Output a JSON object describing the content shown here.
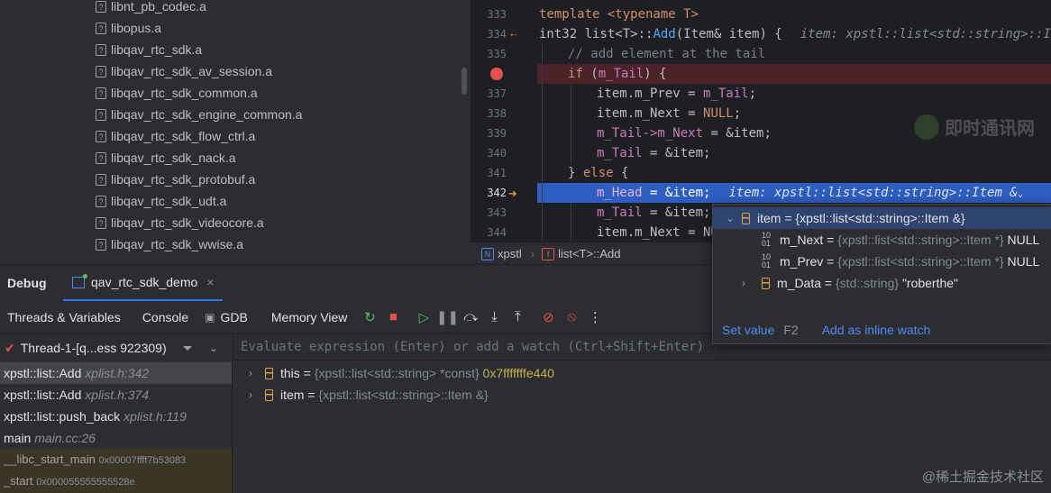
{
  "tree": {
    "files": [
      "libnt_pb_codec.a",
      "libopus.a",
      "libqav_rtc_sdk.a",
      "libqav_rtc_sdk_av_session.a",
      "libqav_rtc_sdk_common.a",
      "libqav_rtc_sdk_engine_common.a",
      "libqav_rtc_sdk_flow_ctrl.a",
      "libqav_rtc_sdk_nack.a",
      "libqav_rtc_sdk_protobuf.a",
      "libqav_rtc_sdk_udt.a",
      "libqav_rtc_sdk_videocore.a",
      "libqav_rtc_sdk_wwise.a"
    ],
    "file_icon": "?"
  },
  "editor": {
    "line_numbers": [
      "333",
      "334",
      "335",
      "",
      "337",
      "338",
      "339",
      "340",
      "341",
      "342",
      "343",
      "344"
    ],
    "l333": "template <typename T>",
    "l334_a": "int32 list<T>::",
    "l334_fn": "Add",
    "l334_b": "(Item& item) {",
    "l334_hint": "item: xpstl::list<std::string>::Item",
    "l335": "// add element at the tail",
    "l336_kw": "if",
    "l336_a": " (",
    "l336_f": "m_Tail",
    "l336_b": ") {",
    "l337_f": "item.m_Prev",
    "l337_b": " = ",
    "l337_c": "m_Tail",
    "l337_d": ";",
    "l338_f": "item.m_Next",
    "l338_b": " = ",
    "l338_c": "NULL",
    "l338_d": ";",
    "l339_f": "m_Tail->m_Next",
    "l339_b": " = &item;",
    "l340_f": "m_Tail",
    "l340_b": " = &item;",
    "l341_a": "} ",
    "l341_kw": "else",
    "l341_b": " {",
    "l342_f": "m_Head",
    "l342_b": " = &item;",
    "l342_hint": "item: xpstl::list<std::string>::Item &",
    "l343_f": "m_Tail",
    "l343_b": " = &item;",
    "l344_f": "item.m_Next",
    "l344_b": " = NU",
    "watermark": "即时通讯网"
  },
  "breadcrumb": {
    "ns_icon": "N",
    "ns": "xpstl",
    "fn_icon": "f",
    "fn": "list<T>::Add"
  },
  "debug": {
    "title": "Debug",
    "session": "qav_rtc_sdk_demo",
    "close": "×",
    "tabs": [
      "Threads & Variables",
      "Console",
      "GDB",
      "Memory View"
    ],
    "thread": "Thread-1-[q...ess 922309)",
    "eval_placeholder": "Evaluate expression (Enter) or add a watch (Ctrl+Shift+Enter)",
    "frames": [
      {
        "fn": "xpstl::list::",
        "name": "Add",
        "loc": "xplist.h:342"
      },
      {
        "fn": "xpstl::list::",
        "name": "Add",
        "loc": "xplist.h:374"
      },
      {
        "fn": "xpstl::list::",
        "name": "push_back",
        "loc": "xplist.h:119"
      },
      {
        "fn": "",
        "name": "main",
        "loc": "main.cc:26"
      },
      {
        "fn": "__libc_start_main",
        "addr": "0x00007ffff7b53083"
      },
      {
        "fn": "_start",
        "addr": "0x000055555555528e"
      }
    ],
    "variables": [
      {
        "name": "this",
        "type": "{xpstl::list<std::string> *const}",
        "value": "0x7fffffffe440"
      },
      {
        "name": "item",
        "type": "{xpstl::list<std::string>::Item &}",
        "value": ""
      }
    ],
    "footer_watermark": "@稀土掘金技术社区"
  },
  "popup": {
    "root": "item = {xpstl::list<std::string>::Item &}",
    "children": [
      {
        "name": "m_Next",
        "type": "{xpstl::list<std::string>::Item *}",
        "value": "NULL"
      },
      {
        "name": "m_Prev",
        "type": "{xpstl::list<std::string>::Item *}",
        "value": "NULL"
      },
      {
        "name": "m_Data",
        "type": "{std::string}",
        "value": "\"roberthe\""
      }
    ],
    "set_value": "Set value",
    "set_value_key": "F2",
    "inline_watch": "Add as inline watch"
  },
  "colors": {
    "accent": "#3574f0",
    "breakpoint": "#e5534b",
    "exec_line": "#2e5ec2",
    "keyword": "#cf8e6d"
  }
}
